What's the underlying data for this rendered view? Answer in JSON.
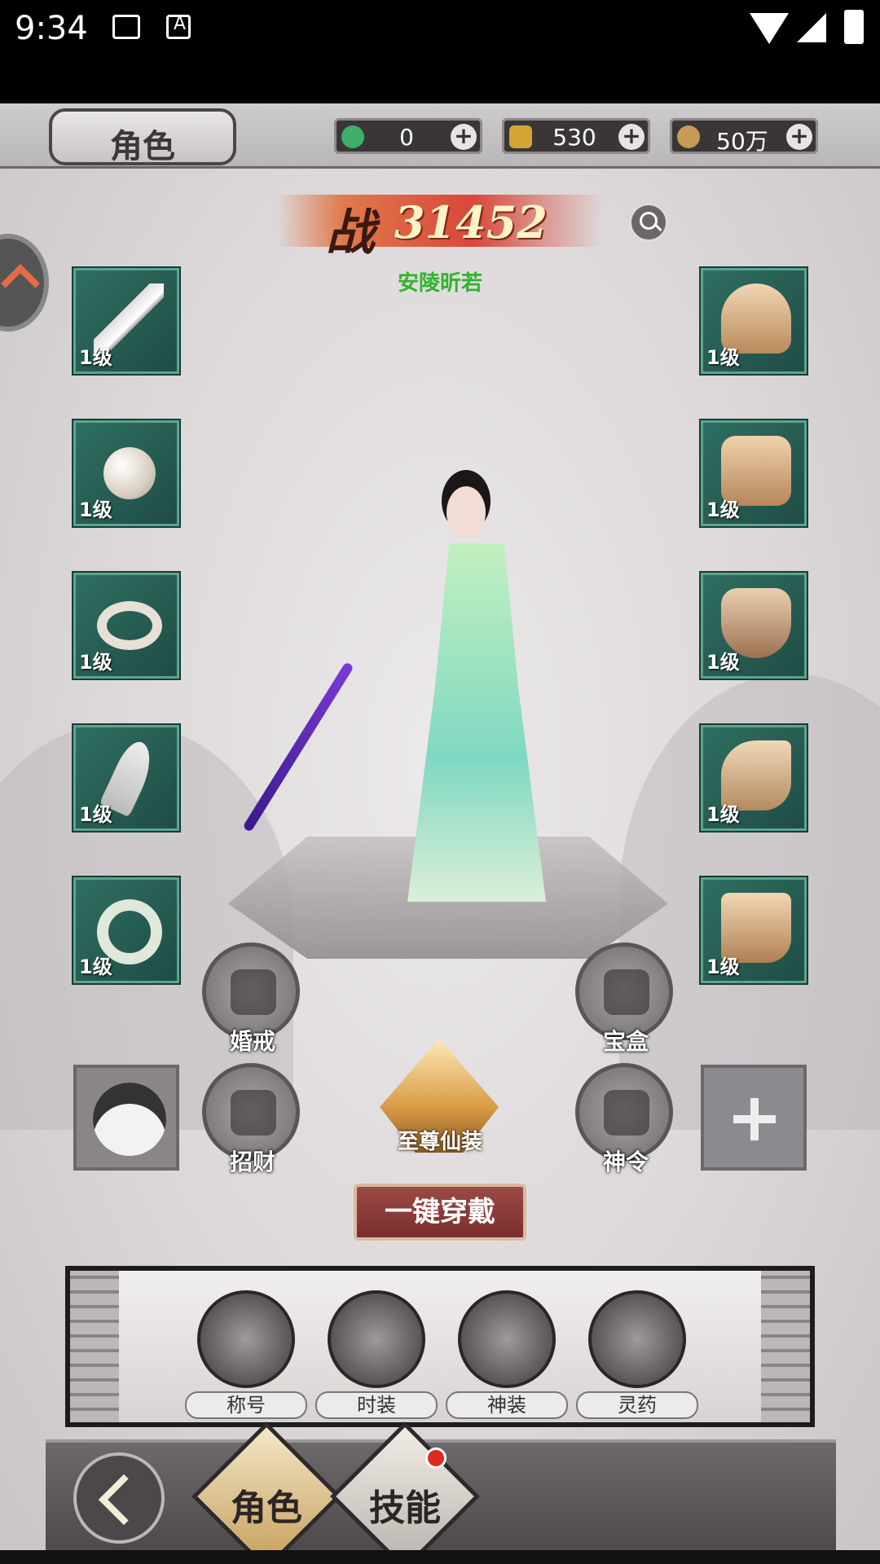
{
  "status_bar": {
    "time": "9:34"
  },
  "header": {
    "title": "角色",
    "currencies": [
      {
        "icon": "jade-currency-icon",
        "value": "0",
        "color": "#3fae6a"
      },
      {
        "icon": "gold-ingot-icon",
        "value": "530",
        "color": "#d4a536"
      },
      {
        "icon": "copper-coin-icon",
        "value": "50万",
        "color": "#c79a55"
      }
    ]
  },
  "power": {
    "label": "战",
    "value": "31452"
  },
  "character": {
    "name": "安陵昕若"
  },
  "equipment": {
    "left": [
      {
        "name": "sword",
        "level": "1级"
      },
      {
        "name": "pendant",
        "level": "1级"
      },
      {
        "name": "ring",
        "level": "1级"
      },
      {
        "name": "ruyi",
        "level": "1级"
      },
      {
        "name": "jade-bracelet",
        "level": "1级"
      }
    ],
    "right": [
      {
        "name": "helmet",
        "level": "1级"
      },
      {
        "name": "armor",
        "level": "1级"
      },
      {
        "name": "shoulder",
        "level": "1级"
      },
      {
        "name": "bracer",
        "level": "1级"
      },
      {
        "name": "boots",
        "level": "1级"
      }
    ]
  },
  "functions": {
    "wedding_ring": "婚戒",
    "treasure_box": "宝盒",
    "fortune": "招财",
    "divine_order": "神令",
    "supreme": "至尊仙装"
  },
  "one_key_equip": "一键穿戴",
  "tabs": [
    "称号",
    "时装",
    "神装",
    "灵药"
  ],
  "bottom_nav": {
    "role": "角色",
    "skills": "技能"
  }
}
